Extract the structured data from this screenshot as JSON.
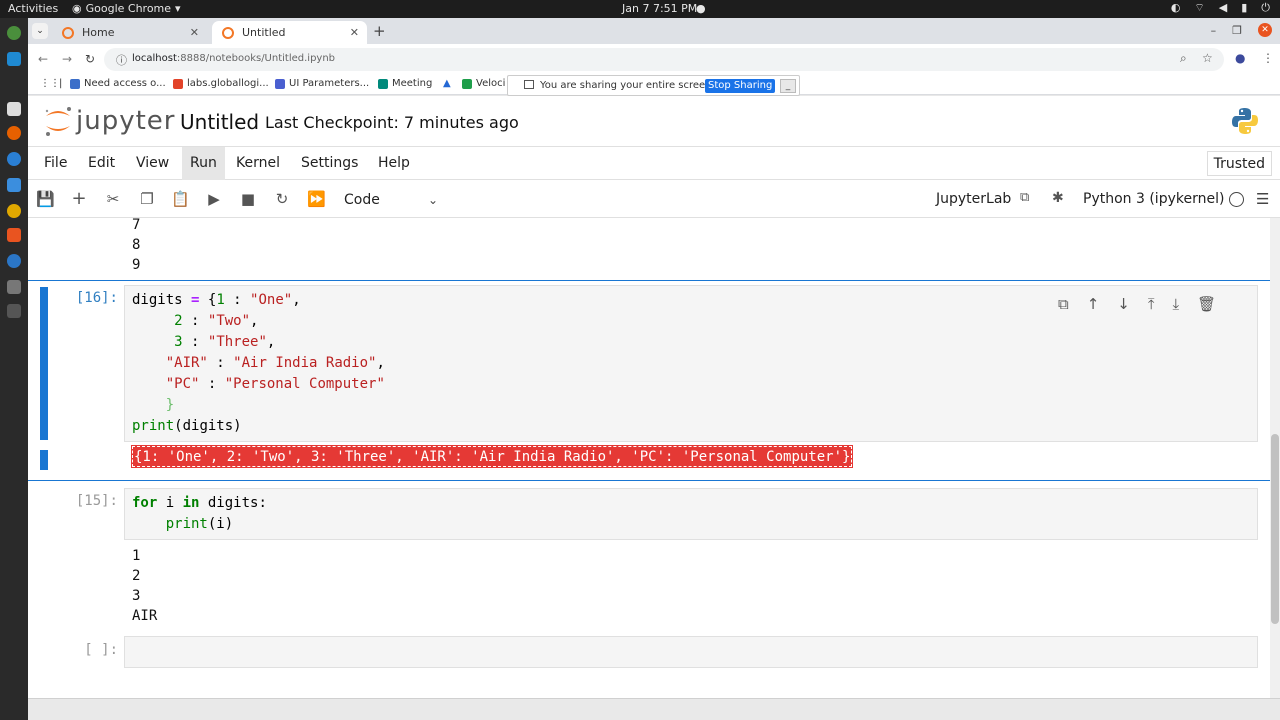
{
  "os": {
    "activities": "Activities",
    "app_name": "Google Chrome",
    "clock": "Jan 7  7:51 PM"
  },
  "browser": {
    "tabs": [
      {
        "label": "Home"
      },
      {
        "label": "Untitled"
      }
    ],
    "url_host": "localhost",
    "url_rest": ":8888/notebooks/Untitled.ipynb",
    "bookmarks": [
      {
        "label": "Need access o..."
      },
      {
        "label": "labs.globallogi..."
      },
      {
        "label": "UI Parameters..."
      },
      {
        "label": "Meeting"
      },
      {
        "label": "Veloci"
      }
    ],
    "share_bar": {
      "message": "You are sharing your entire screen.",
      "stop_label": "Stop Sharing",
      "hide_label": "_"
    }
  },
  "jupyter": {
    "wordmark": "jupyter",
    "notebook_title": "Untitled",
    "checkpoint": "Last Checkpoint: 7 minutes ago",
    "menu": [
      "File",
      "Edit",
      "View",
      "Run",
      "Kernel",
      "Settings",
      "Help"
    ],
    "trusted": "Trusted",
    "cell_type": "Code",
    "jupyterlab_label": "JupyterLab",
    "kernel_name": "Python 3 (ipykernel)"
  },
  "cells": {
    "prev_output": [
      "7",
      "8",
      "9"
    ],
    "cell16": {
      "prompt": "[16]:",
      "output": "{1: 'One', 2: 'Two', 3: 'Three', 'AIR': 'Air India Radio', 'PC': 'Personal Computer'}"
    },
    "cell15": {
      "prompt": "[15]:",
      "output": [
        "1",
        "2",
        "3",
        "AIR"
      ]
    },
    "empty": {
      "prompt": "[ ]:"
    }
  }
}
